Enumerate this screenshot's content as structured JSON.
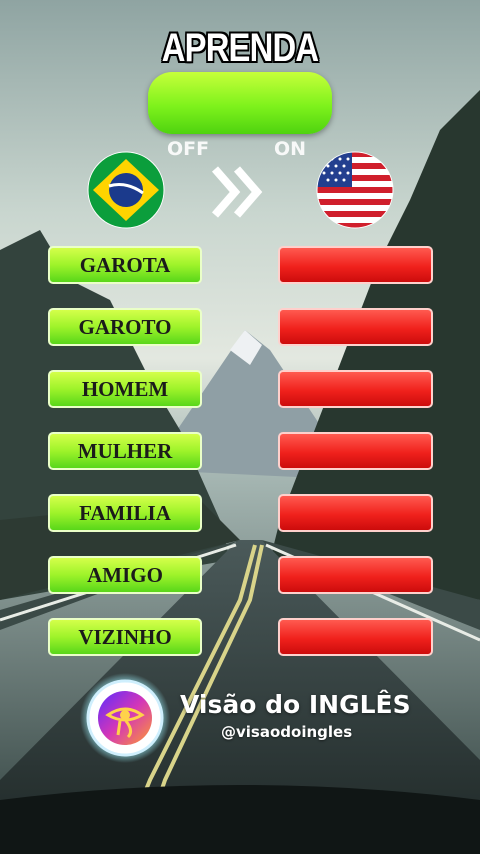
{
  "title": "APRENDA",
  "toggle": {
    "off_label": "OFF",
    "on_label": "ON",
    "state": "on"
  },
  "flags": {
    "source": "brazil-flag-icon",
    "target": "usa-flag-icon",
    "arrow": "double-chevron-right-icon"
  },
  "words": [
    "GAROTA",
    "GAROTO",
    "HOMEM",
    "MULHER",
    "FAMILIA",
    "AMIGO",
    "VIZINHO"
  ],
  "translations_hidden": true,
  "brand": {
    "name": "Visão do INGLÊS",
    "handle": "@visaodoingles",
    "logo_icon": "eye-of-horus-logo-icon"
  },
  "colors": {
    "green": "#7ef21c",
    "red": "#f0211c"
  }
}
